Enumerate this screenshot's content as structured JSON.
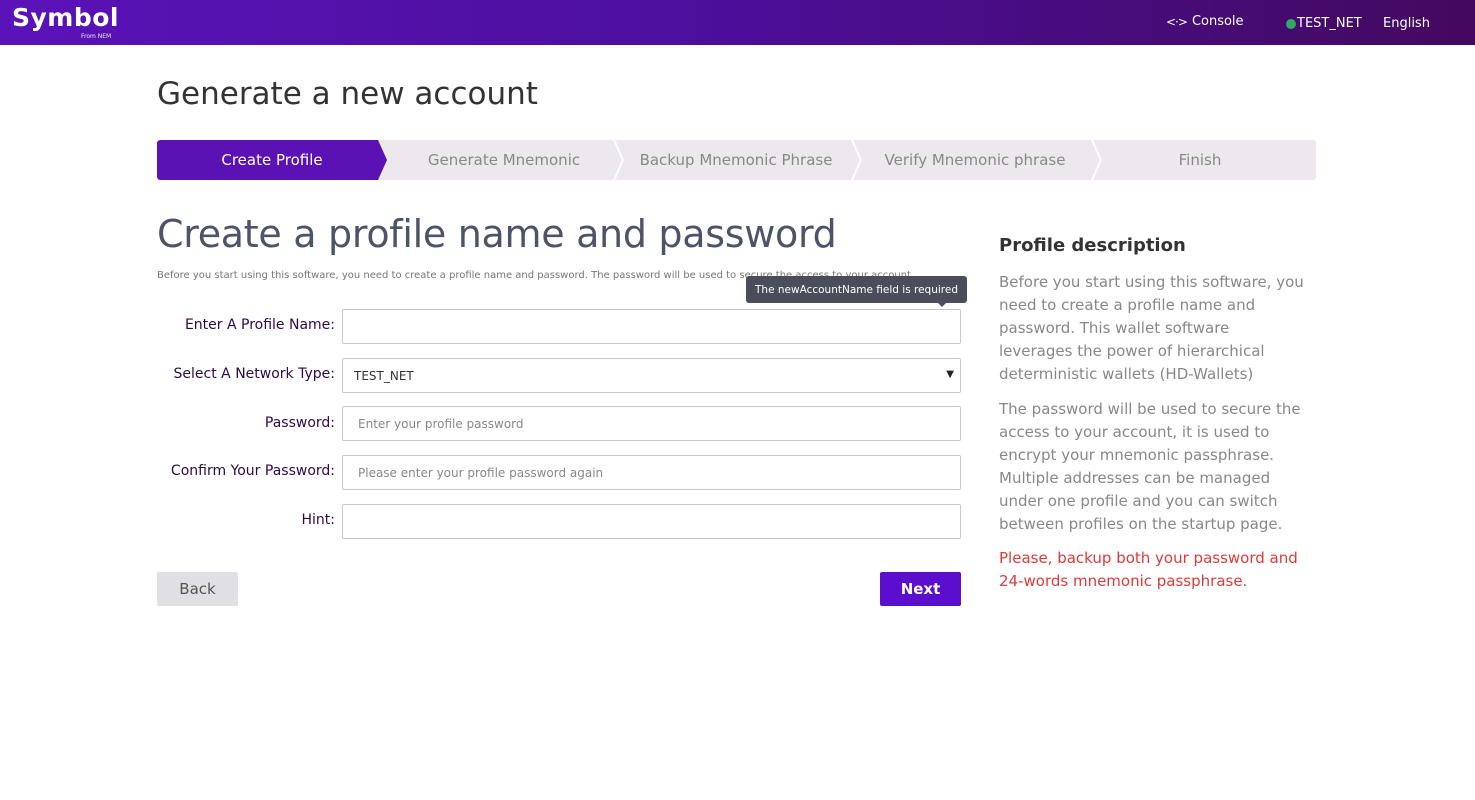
{
  "header": {
    "logo_text": "Symbol",
    "logo_sub": "From NEM",
    "console_label": "Console",
    "network_label": "TEST_NET",
    "language": "English"
  },
  "page": {
    "title": "Generate a new account"
  },
  "stepper": {
    "steps": [
      {
        "label": "Create Profile",
        "active": true
      },
      {
        "label": "Generate Mnemonic",
        "active": false
      },
      {
        "label": "Backup Mnemonic Phrase",
        "active": false
      },
      {
        "label": "Verify Mnemonic phrase",
        "active": false
      },
      {
        "label": "Finish",
        "active": false
      }
    ]
  },
  "form": {
    "title": "Create a profile name and password",
    "description": "Before you start using this software, you need to create a profile name and password. The password will be used to secure the access to your account.",
    "tooltip": "The newAccountName field is required",
    "fields": {
      "profile_name": {
        "label": "Enter A Profile Name:",
        "value": "",
        "placeholder": ""
      },
      "network_type": {
        "label": "Select A Network Type:",
        "value": "TEST_NET"
      },
      "password": {
        "label": "Password:",
        "value": "",
        "placeholder": "Enter your profile password"
      },
      "confirm_password": {
        "label": "Confirm Your Password:",
        "value": "",
        "placeholder": "Please enter your profile password again"
      },
      "hint": {
        "label": "Hint:",
        "value": "",
        "placeholder": ""
      }
    },
    "back_label": "Back",
    "next_label": "Next"
  },
  "sidebar": {
    "title": "Profile description",
    "paragraph1": "Before you start using this software, you need to create a profile name and password. This wallet software leverages the power of hierarchical deterministic wallets (HD-Wallets)",
    "paragraph2": "The password will be used to secure the access to your account, it is used to encrypt your mnemonic passphrase. Multiple addresses can be managed under one profile and you can switch between profiles on the startup page.",
    "warning": "Please, backup both your password and 24-words mnemonic passphrase."
  },
  "colors": {
    "brand": "#5a12b5",
    "warning": "#e03a3a",
    "network_ok": "#2eaa62"
  },
  "icons": {
    "console": "code-arrows-icon",
    "network": "status-dot-icon",
    "select": "caret-down-icon"
  }
}
